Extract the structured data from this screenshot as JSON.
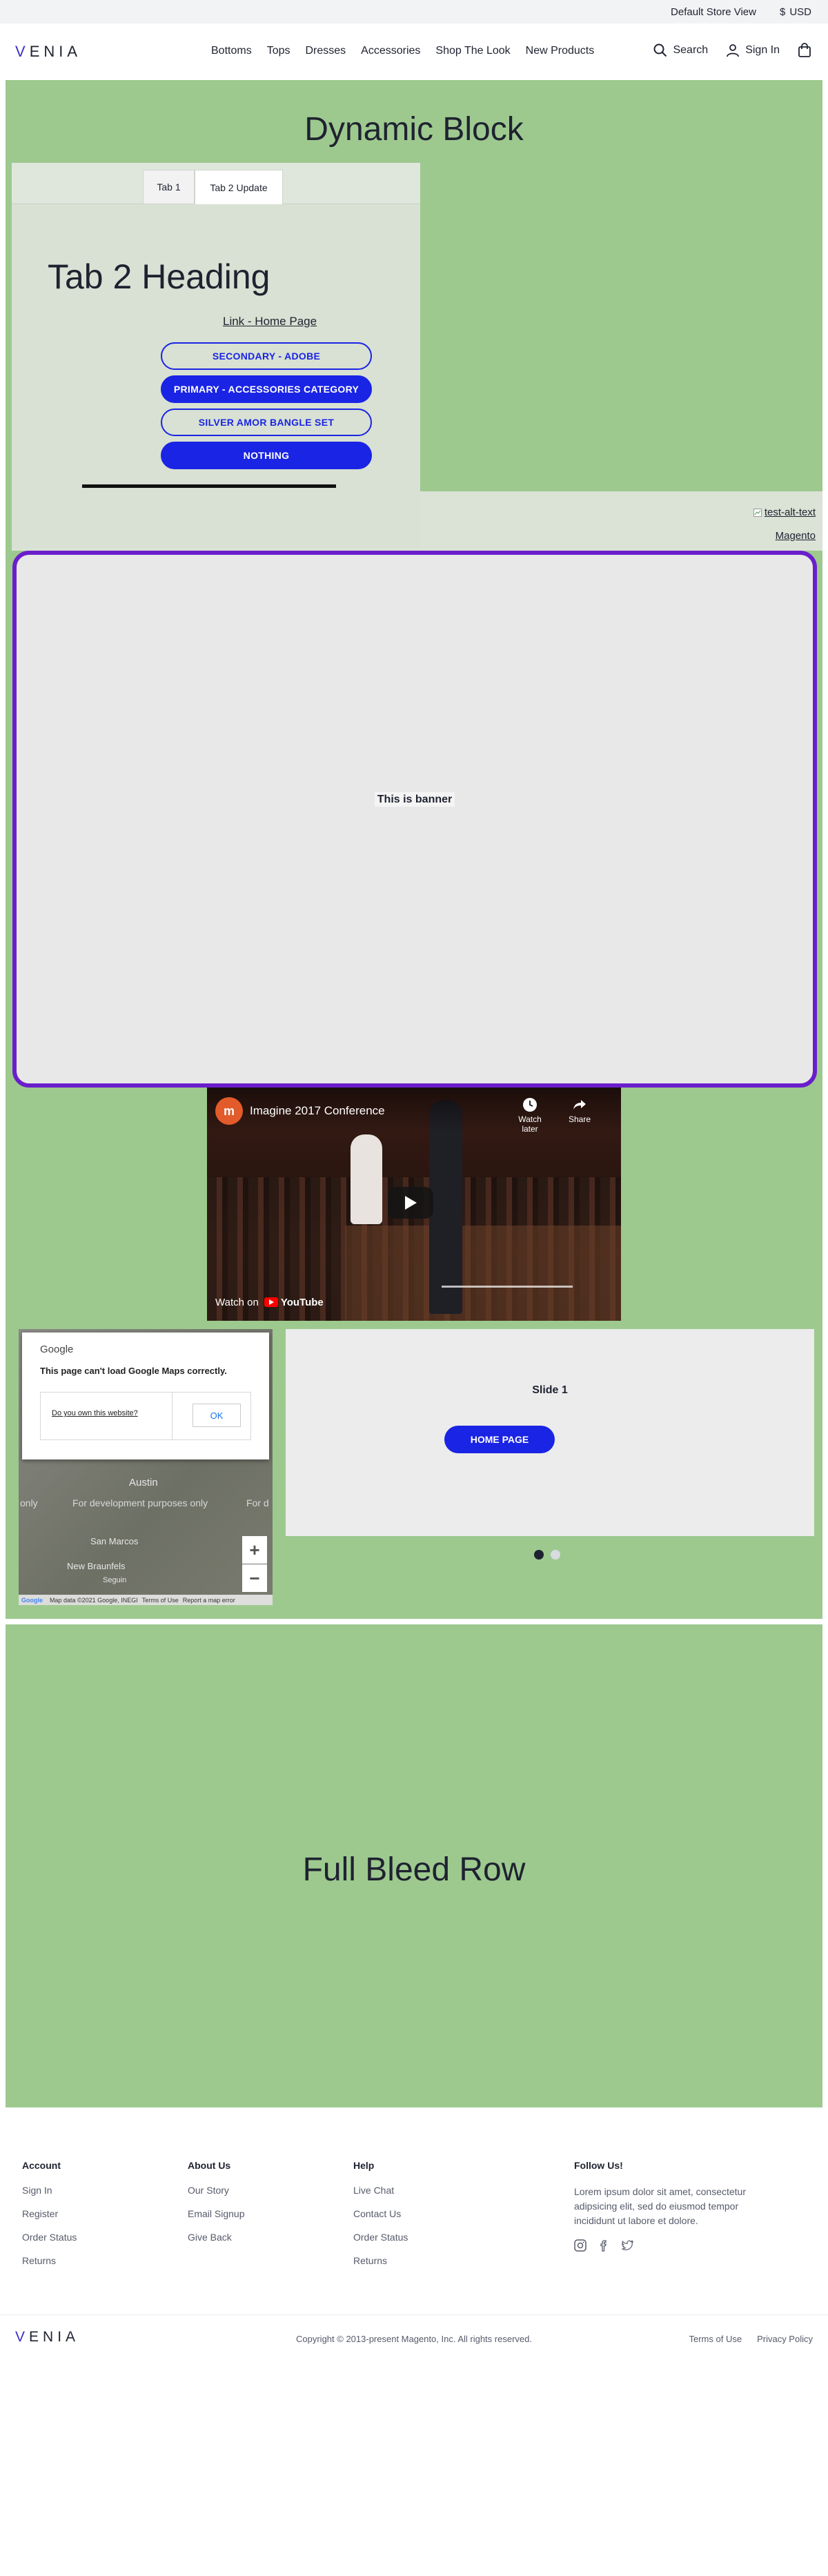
{
  "utility": {
    "store_view": "Default Store View",
    "currency": "USD",
    "currency_symbol": "$"
  },
  "header": {
    "logo": "ENIA",
    "logo_first": "V",
    "nav": [
      "Bottoms",
      "Tops",
      "Dresses",
      "Accessories",
      "Shop The Look",
      "New Products"
    ],
    "search_label": "Search",
    "signin_label": "Sign In"
  },
  "dynamic_block": {
    "title": "Dynamic Block",
    "tabs": [
      {
        "label": "Tab 1",
        "active": false
      },
      {
        "label": "Tab 2 Update",
        "active": true
      }
    ],
    "tab_heading": "Tab 2 Heading",
    "home_link": "Link - Home Page",
    "buttons": [
      {
        "label": "SECONDARY - ADOBE",
        "style": "outline"
      },
      {
        "label": "PRIMARY - ACCESSORIES CATEGORY",
        "style": "solid"
      },
      {
        "label": "SILVER AMOR BANGLE SET",
        "style": "outline"
      },
      {
        "label": "NOTHING",
        "style": "solid"
      }
    ],
    "image_alt": "test-alt-text",
    "magento_link": "Magento",
    "banner_text": "This is banner"
  },
  "video": {
    "title": "Imagine 2017 Conference",
    "watch_later": "Watch later",
    "share": "Share",
    "watch_on": "Watch on",
    "youtube": "YouTube"
  },
  "map": {
    "google": "Google",
    "message": "This page can't load Google Maps correctly.",
    "own_link": "Do you own this website?",
    "ok": "OK",
    "city_austin": "Austin",
    "city_san_marcos": "San Marcos",
    "city_new_braunfels": "New Braunfels",
    "city_seguin": "Seguin",
    "dev_text": "For development purposes only",
    "dev_text_left": "only",
    "dev_text_right": "For d",
    "zoom_in": "+",
    "zoom_out": "−",
    "footer_data": "Map data ©2021 Google, INEGI",
    "footer_terms": "Terms of Use",
    "footer_report": "Report a map error"
  },
  "slider": {
    "slide_title": "Slide 1",
    "button": "HOME PAGE",
    "active_index": 0,
    "count": 2
  },
  "full_bleed": {
    "title": "Full Bleed Row"
  },
  "footer": {
    "account": {
      "heading": "Account",
      "links": [
        "Sign In",
        "Register",
        "Order Status",
        "Returns"
      ]
    },
    "about": {
      "heading": "About Us",
      "links": [
        "Our Story",
        "Email Signup",
        "Give Back"
      ]
    },
    "help": {
      "heading": "Help",
      "links": [
        "Live Chat",
        "Contact Us",
        "Order Status",
        "Returns"
      ]
    },
    "follow": {
      "heading": "Follow Us!",
      "text": "Lorem ipsum dolor sit amet, consectetur adipsicing elit, sed do eiusmod tempor incididunt ut labore et dolore.",
      "icons": [
        "instagram-icon",
        "facebook-icon",
        "twitter-icon"
      ]
    },
    "logo": "ENIA",
    "logo_first": "V",
    "copyright": "Copyright © 2013-present Magento, Inc. All rights reserved.",
    "terms": "Terms of Use",
    "privacy": "Privacy Policy"
  },
  "colors": {
    "green": "#9dc98f",
    "primary": "#1a24e4",
    "banner_border": "#6a1ecb",
    "brand_v": "#3b2fc9"
  }
}
